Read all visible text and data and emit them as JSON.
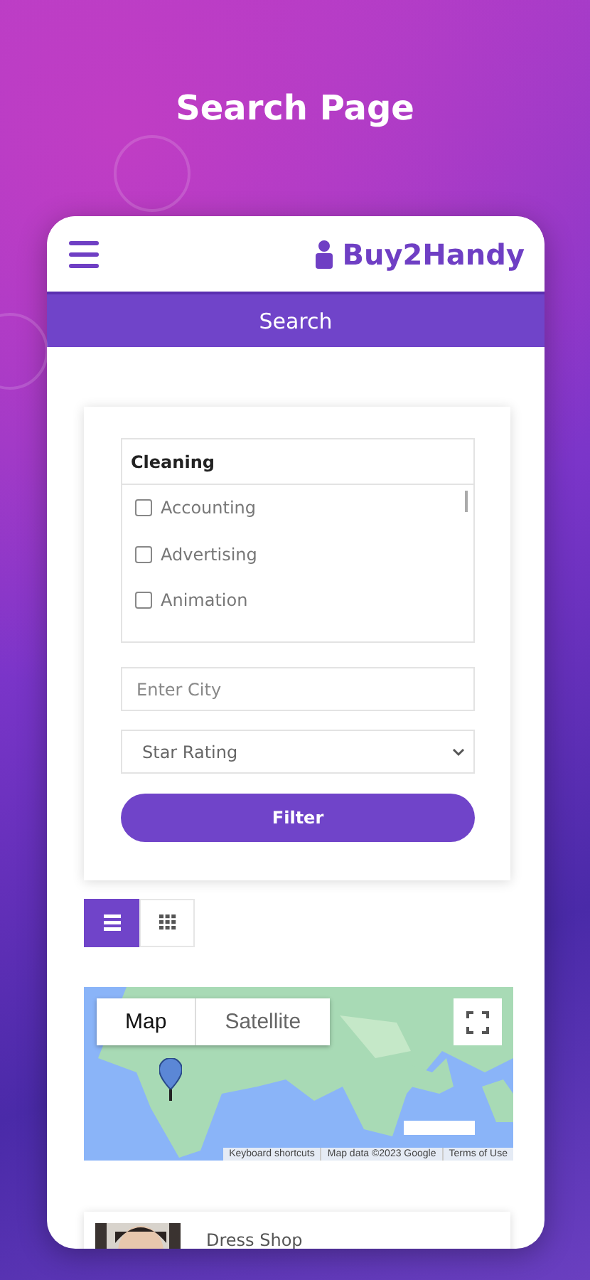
{
  "page_title": "Search Page",
  "app": {
    "brand": "Buy2Handy"
  },
  "search_bar": {
    "title": "Search"
  },
  "filter": {
    "category_header": "Cleaning",
    "categories": [
      {
        "label": "Accounting",
        "checked": false
      },
      {
        "label": "Advertising",
        "checked": false
      },
      {
        "label": "Animation",
        "checked": false
      }
    ],
    "city": {
      "placeholder": "Enter City"
    },
    "rating": {
      "value": "Star Rating"
    },
    "button": "Filter"
  },
  "view_toggle": [
    {
      "kind": "list",
      "selected": true
    },
    {
      "kind": "grid",
      "selected": false
    }
  ],
  "map": {
    "map_types": [
      {
        "label": "Map",
        "selected": true
      },
      {
        "label": "Satellite",
        "selected": false
      }
    ],
    "attribution": [
      "Keyboard shortcuts",
      "Map data ©2023 Google",
      "Terms of Use"
    ]
  },
  "listings": [
    {
      "name": "Dress Shop"
    }
  ]
}
